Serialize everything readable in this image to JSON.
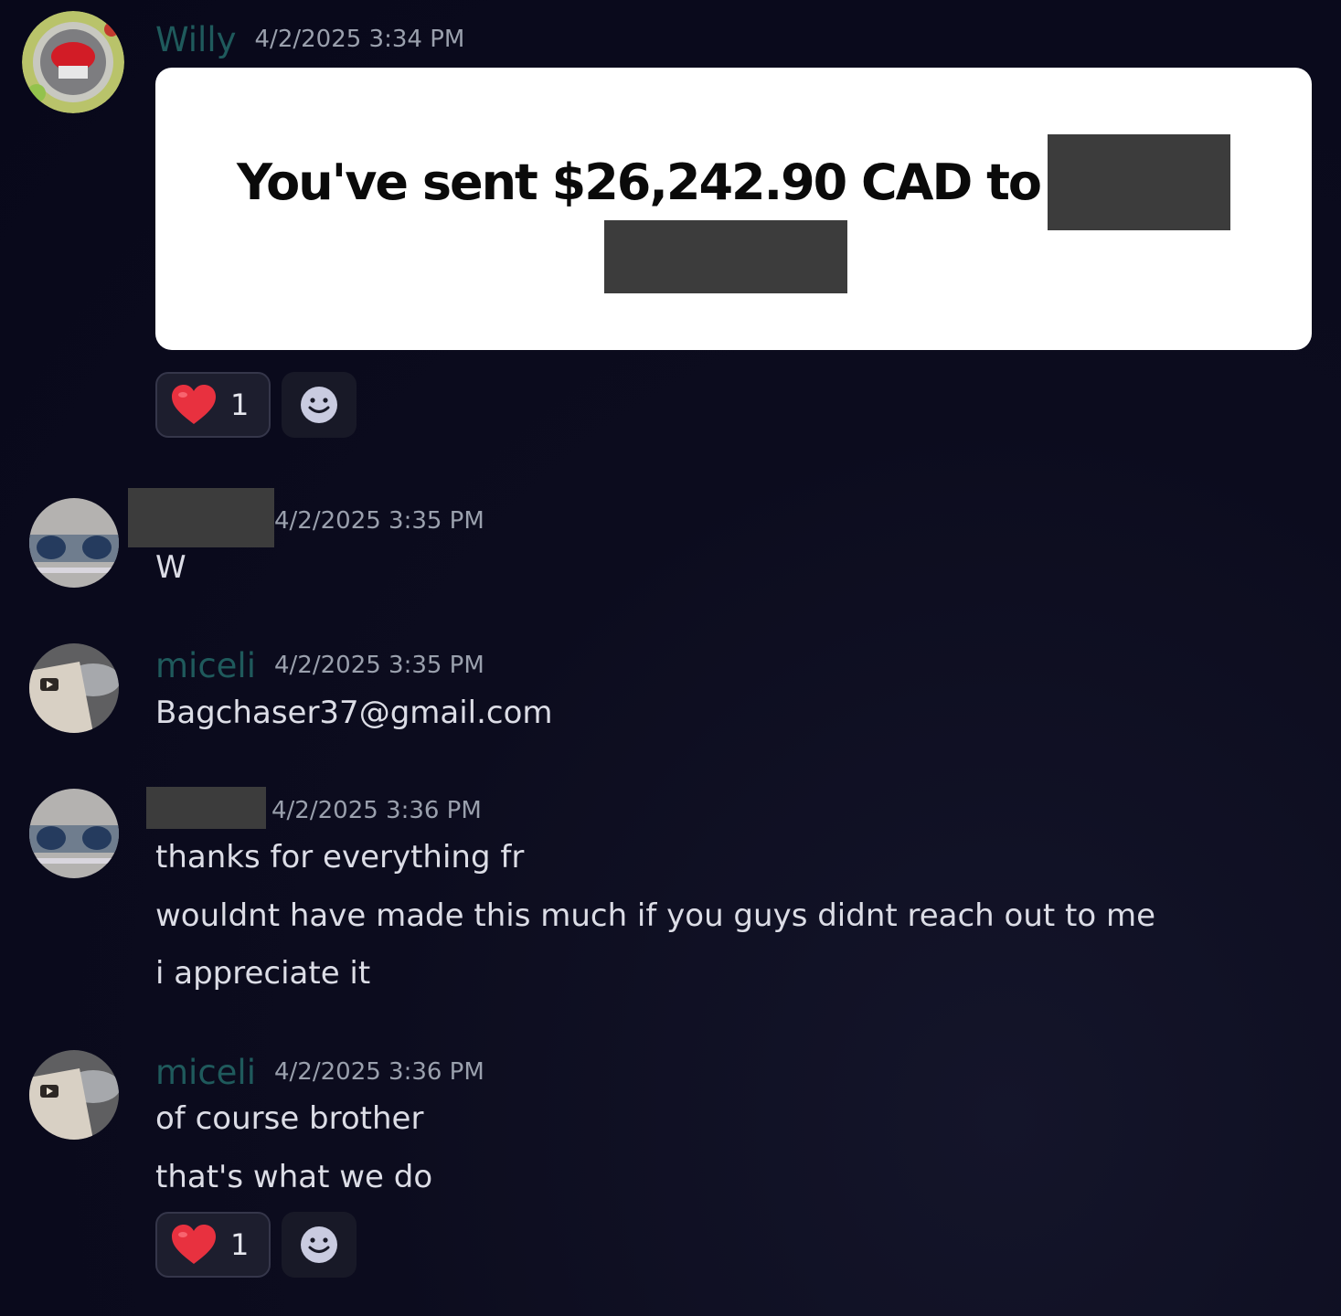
{
  "messages": [
    {
      "username": "Willy",
      "timestamp": "4/2/2025 3:34 PM",
      "embed": {
        "text": "You've sent $26,242.90 CAD to"
      },
      "reactions": [
        {
          "emoji": "heart-icon",
          "count": "1"
        }
      ]
    },
    {
      "username": "",
      "timestamp": "4/2/2025 3:35 PM",
      "lines": [
        "W"
      ]
    },
    {
      "username": "miceli",
      "timestamp": "4/2/2025 3:35 PM",
      "lines": [
        "Bagchaser37@gmail.com"
      ]
    },
    {
      "username": "",
      "timestamp": "4/2/2025 3:36 PM",
      "lines": [
        "thanks for everything fr",
        "wouldnt have made this much if you guys didnt reach out to me",
        "i appreciate it"
      ]
    },
    {
      "username": "miceli",
      "timestamp": "4/2/2025 3:36 PM",
      "lines": [
        "of course brother",
        "that's what we do"
      ],
      "reactions": [
        {
          "emoji": "heart-icon",
          "count": "1"
        }
      ]
    }
  ],
  "colors": {
    "background": "#0c0c1e",
    "username": "#1f5a5c",
    "timestamp": "#9aa0ad",
    "text": "#dcdde6",
    "heart": "#e8313f",
    "redaction": "#3c3c3c"
  }
}
